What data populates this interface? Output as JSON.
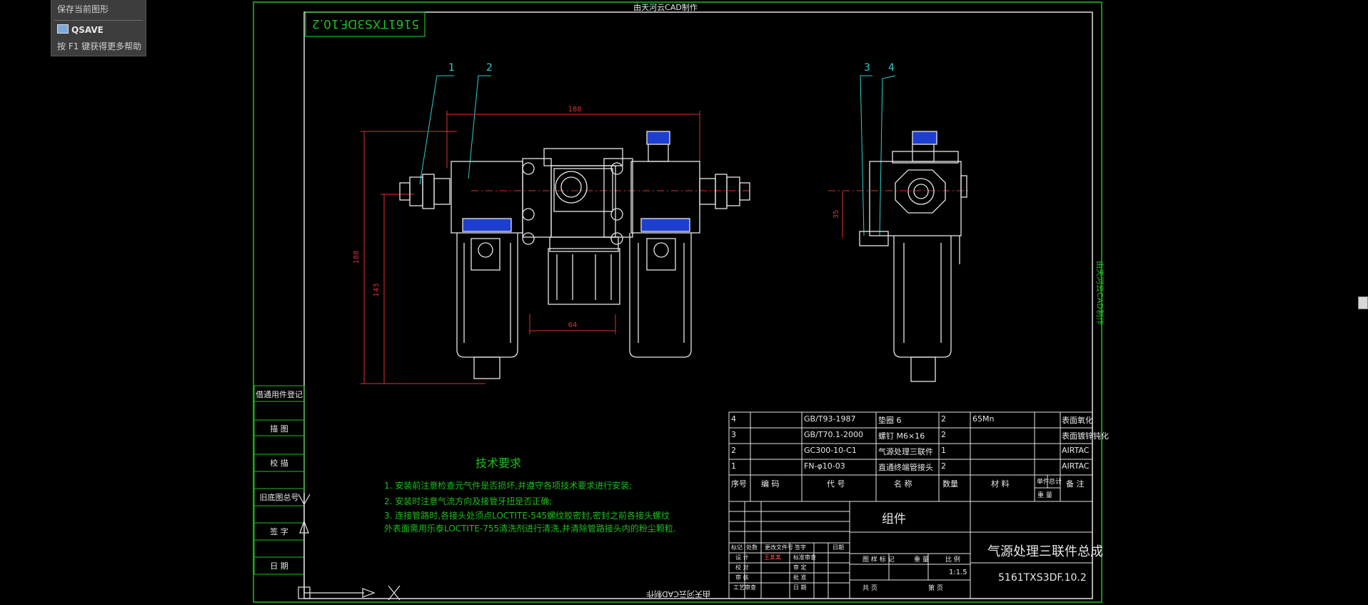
{
  "tooltip": {
    "title": "保存当前图形",
    "command": "QSAVE",
    "help": "按 F1 键获得更多帮助"
  },
  "drawing": {
    "watermark_top": "由天河云CAD制作",
    "watermark_bottom": "由天河云CAD制作",
    "watermark_side": "由天河云CAD制作",
    "drawing_no_rotated": "5161TXS3DF.10.2",
    "balloons": [
      "1",
      "2",
      "3",
      "4"
    ],
    "dimensions": {
      "overall_width": "188",
      "overall_height": "188",
      "lower_height": "143",
      "gauge_width": "64",
      "side_offset": "35"
    },
    "side_labels": [
      "借通用件登记",
      "描 图",
      "校 描",
      "旧底图总号",
      "签 字",
      "日 期"
    ],
    "tech_requirements": {
      "title": "技术要求",
      "items": [
        "1. 安装前注意检查元气件是否损坏,并遵守各项技术要求进行安装;",
        "2. 安装时注意气流方向及接管牙扭是否正确;",
        "3. 连接管路时,各接头处须点LOCTITE-545螺纹胶密封,密封之前各接头螺纹",
        "   外表面需用乐泰LOCTITE-755清洗剂进行清洗,并清除管路接头内的粉尘颗粒."
      ]
    }
  },
  "bom": {
    "rows": [
      {
        "seq": "4",
        "code": "",
        "spec": "GB/T93-1987",
        "name": "垫圈 6",
        "qty": "2",
        "material": "65Mn",
        "unit_w": "",
        "total_w": "",
        "note": "表面氧化"
      },
      {
        "seq": "3",
        "code": "",
        "spec": "GB/T70.1-2000",
        "name": "螺钉 M6×16",
        "qty": "2",
        "material": "",
        "unit_w": "",
        "total_w": "",
        "note": "表面镀锌钝化"
      },
      {
        "seq": "2",
        "code": "",
        "spec": "GC300-10-C1",
        "name": "气源处理三联件",
        "qty": "1",
        "material": "",
        "unit_w": "",
        "total_w": "",
        "note": "AIRTAC"
      },
      {
        "seq": "1",
        "code": "",
        "spec": "FN-φ10-03",
        "name": "直通终端管接头",
        "qty": "2",
        "material": "",
        "unit_w": "",
        "total_w": "",
        "note": "AIRTAC"
      }
    ],
    "header": {
      "seq": "序号",
      "code": "编 码",
      "spec": "代 号",
      "name": "名 称",
      "qty": "数量",
      "material": "材 料",
      "unit_w": "单件",
      "total_w": "总计",
      "weight": "重 量",
      "note": "备 注"
    }
  },
  "title_block": {
    "group": "组件",
    "product_name": "气源处理三联件总成",
    "drawing_no": "5161TXS3DF.10.2",
    "scale": "1:1.5",
    "labels": {
      "mark": "标记",
      "count": "处数",
      "change_doc": "更改文件号",
      "sign": "签字",
      "date": "日期",
      "design": "设 计",
      "standard": "标准审查",
      "check": "校 对",
      "review": "审 定",
      "audit": "审 核",
      "approve": "批 准",
      "process": "工艺审查",
      "date2": "日 期",
      "stage_mark": "图 样 标 记",
      "weight": "重 量",
      "ratio": "比 例",
      "sheet_total": "共 页",
      "sheet": "第 页"
    },
    "designer_stamp": "王某某"
  }
}
